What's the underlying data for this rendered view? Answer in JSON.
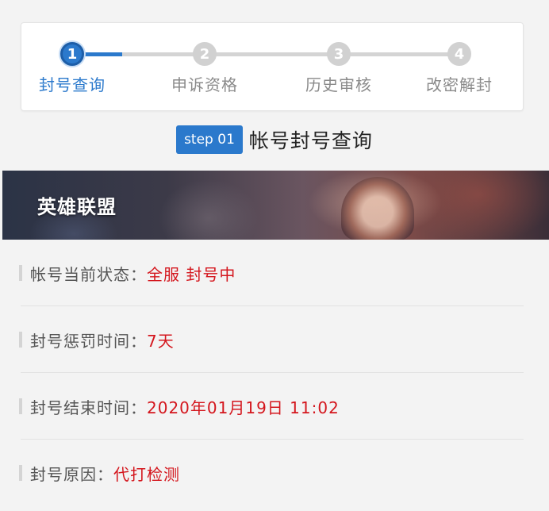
{
  "stepper": {
    "steps": [
      {
        "number": "1",
        "label": "封号查询"
      },
      {
        "number": "2",
        "label": "申诉资格"
      },
      {
        "number": "3",
        "label": "历史审核"
      },
      {
        "number": "4",
        "label": "改密解封"
      }
    ],
    "active_step": 1,
    "progress_fraction": 0.13
  },
  "step_heading": {
    "badge": "step 01",
    "title": "帐号封号查询"
  },
  "banner": {
    "title": "英雄联盟"
  },
  "info_rows": [
    {
      "label": "帐号当前状态：",
      "value": "全服 封号中"
    },
    {
      "label": "封号惩罚时间：",
      "value": "7天"
    },
    {
      "label": "封号结束时间：",
      "value": "2020年01月19日 11:02"
    },
    {
      "label": "封号原因：",
      "value": "代打检测"
    }
  ],
  "colors": {
    "accent": "#2b79cc",
    "inactive": "#d1d1d1",
    "value_red": "#d4161d"
  }
}
